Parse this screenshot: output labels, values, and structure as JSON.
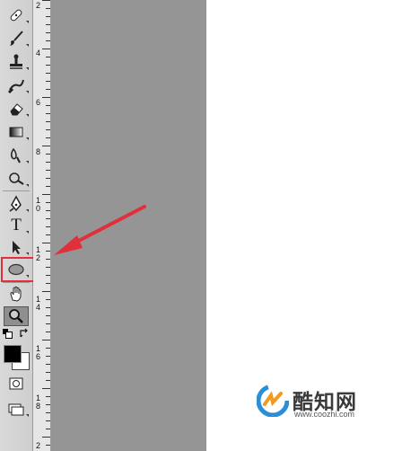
{
  "tools": [
    {
      "name": "spot-healing-brush-tool"
    },
    {
      "name": "brush-tool"
    },
    {
      "name": "clone-stamp-tool"
    },
    {
      "name": "history-brush-tool"
    },
    {
      "name": "eraser-tool"
    },
    {
      "name": "gradient-tool"
    },
    {
      "name": "blur-tool"
    },
    {
      "name": "dodge-tool"
    },
    {
      "name": "pen-tool"
    },
    {
      "name": "type-tool",
      "glyph": "T"
    },
    {
      "name": "path-selection-tool"
    },
    {
      "name": "ellipse-tool",
      "highlighted": true
    },
    {
      "name": "hand-tool"
    },
    {
      "name": "zoom-tool",
      "selected": true
    }
  ],
  "colors": {
    "foreground": "#000000",
    "background": "#ffffff",
    "highlight": "#e0303b",
    "pasteboard": "#959595"
  },
  "ruler": {
    "labels": [
      "2",
      "4",
      "6",
      "8",
      "1\n0",
      "1\n2",
      "1\n4",
      "1\n6",
      "1\n8",
      "2"
    ]
  },
  "watermark": {
    "name": "酷知网",
    "url": "www.coozhi.com"
  }
}
